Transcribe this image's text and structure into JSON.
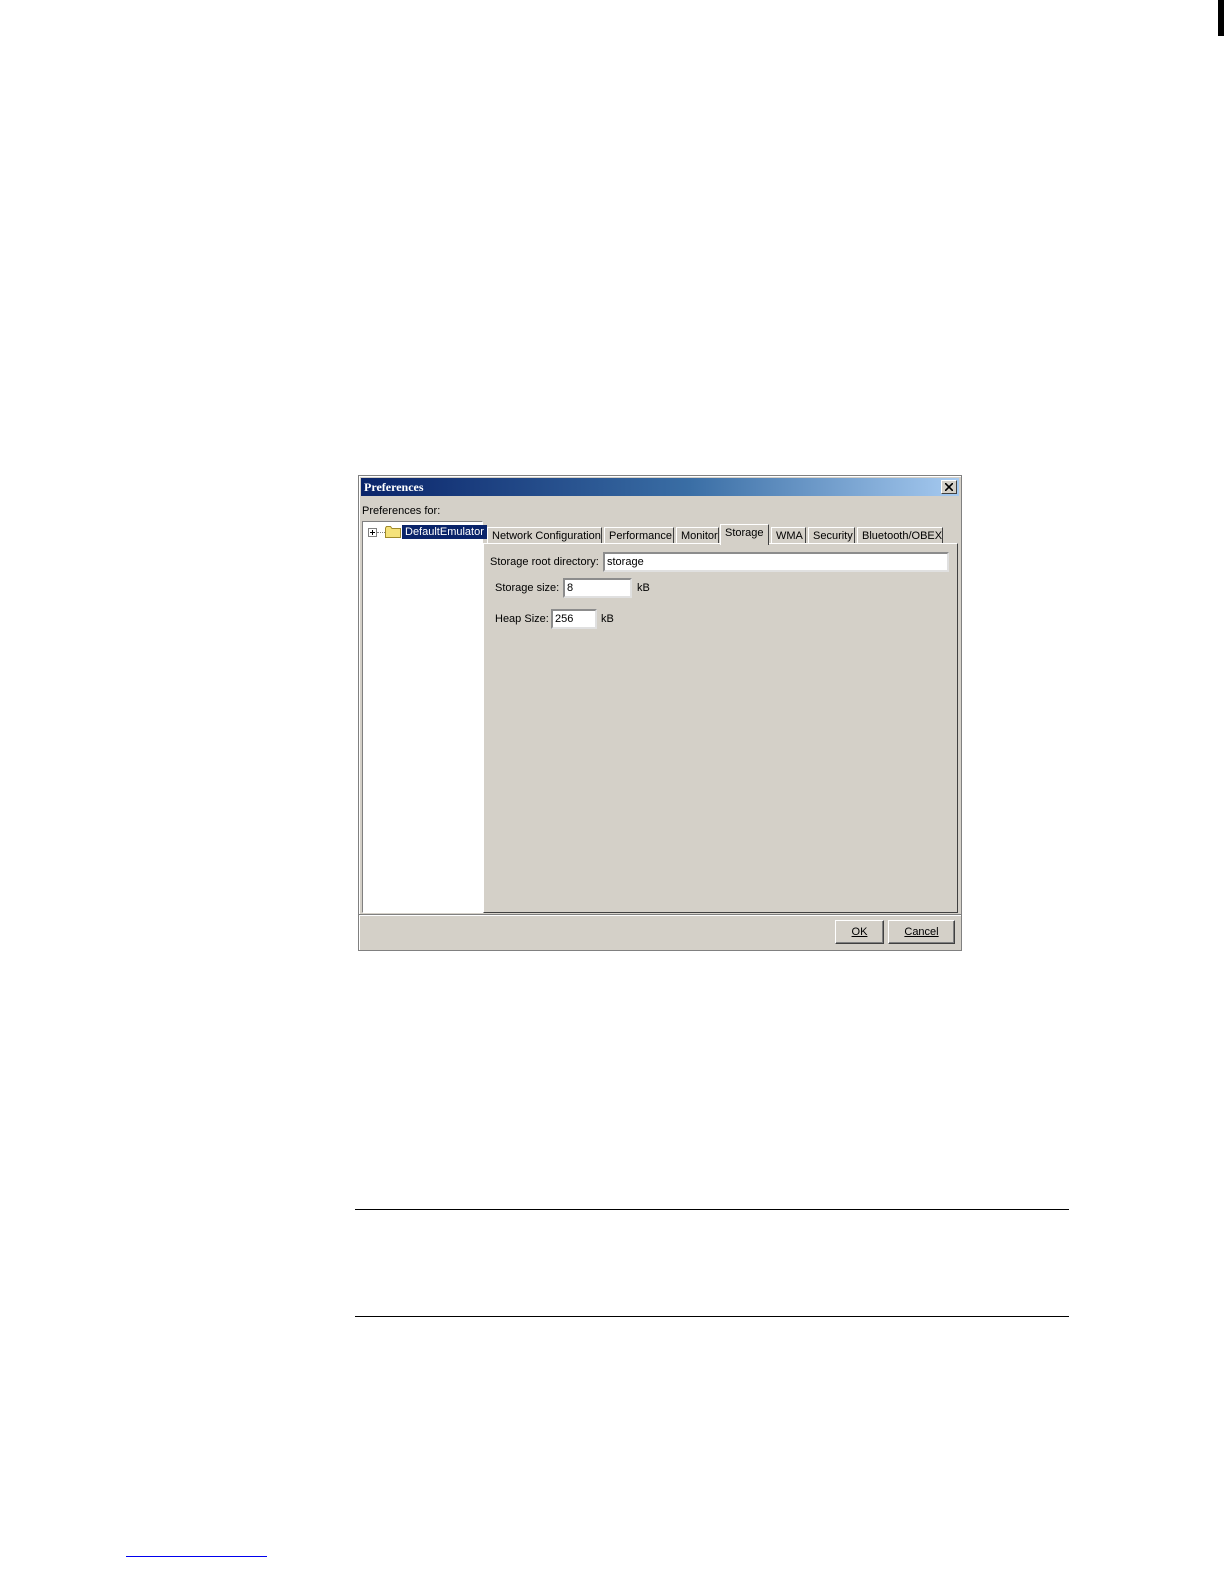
{
  "dialog": {
    "title": "Preferences",
    "preferences_for_label": "Preferences for:",
    "tree": {
      "node_label": "DefaultEmulator"
    },
    "tabs": [
      {
        "label": "Network Configuration"
      },
      {
        "label": "Performance"
      },
      {
        "label": "Monitor"
      },
      {
        "label": "Storage"
      },
      {
        "label": "WMA"
      },
      {
        "label": "Security"
      },
      {
        "label": "Bluetooth/OBEX"
      }
    ],
    "active_tab": "Storage",
    "storage": {
      "root_dir_label": "Storage root directory:",
      "root_dir_value": "storage",
      "size_label": "Storage size:",
      "size_value": "8",
      "size_unit": "kB",
      "heap_label": "Heap Size:",
      "heap_value": "256",
      "heap_unit": "kB"
    },
    "buttons": {
      "ok": "OK",
      "cancel": "Cancel"
    }
  },
  "colors": {
    "titlebar_start": "#0a246a",
    "titlebar_end": "#a6caf0",
    "dialog_bg": "#d4d0c8",
    "selection": "#0a246a"
  }
}
